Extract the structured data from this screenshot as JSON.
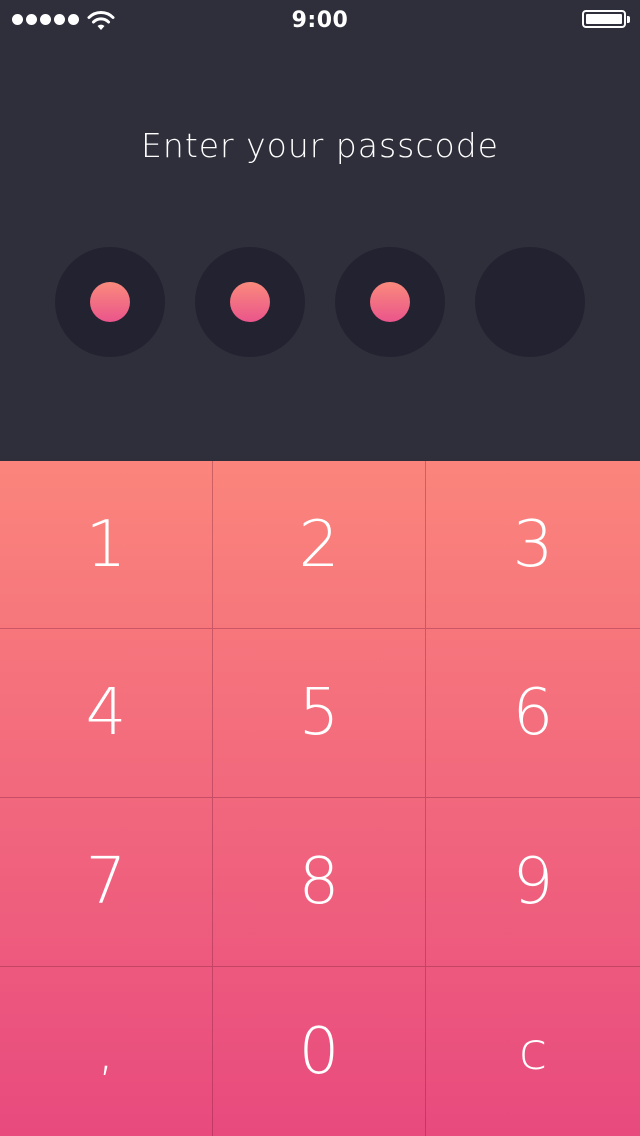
{
  "status_bar": {
    "time": "9:00",
    "signal_bars": 5,
    "wifi_icon": "wifi-icon",
    "battery_level": 1.0
  },
  "prompt": "Enter your passcode",
  "passcode": {
    "length": 4,
    "entered": 3,
    "fill_color_top": "#fa8a7c",
    "fill_color_bottom": "#ea558b"
  },
  "keypad": {
    "keys": [
      "1",
      "2",
      "3",
      "4",
      "5",
      "6",
      "7",
      "8",
      "9",
      ",",
      "0",
      "c"
    ],
    "gradient_top": "#fb857c",
    "gradient_bottom": "#e84a7e"
  },
  "colors": {
    "header_background": "#2f2f3c",
    "slot_background": "#222230",
    "text": "#ffffff"
  }
}
